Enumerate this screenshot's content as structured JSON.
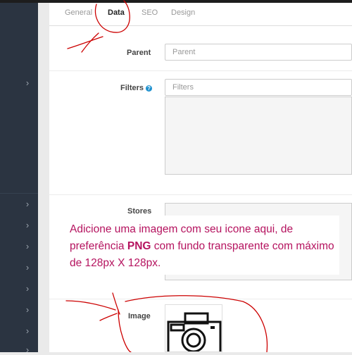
{
  "tabs": [
    {
      "label": "General",
      "active": false
    },
    {
      "label": "Data",
      "active": true
    },
    {
      "label": "SEO",
      "active": false
    },
    {
      "label": "Design",
      "active": false
    }
  ],
  "form": {
    "parent_label": "Parent",
    "parent_placeholder": "Parent",
    "filters_label": "Filters",
    "filters_help_icon": "?",
    "filters_placeholder": "Filters",
    "stores_label": "Stores",
    "image_label": "Image",
    "image_icon": "camera-icon"
  },
  "annotation": {
    "text_start": "Adicione uma imagem com seu icone aqui, de preferência ",
    "text_bold": "PNG",
    "text_end": " com fundo transparente com máximo de 128px X 128px.",
    "color": "#b5135f"
  },
  "sidebar": {
    "arrow_glyph": "›"
  },
  "colors": {
    "sidebar_bg": "#2b3441",
    "help_icon": "#1e91cf",
    "pen_red": "#cc0000"
  }
}
